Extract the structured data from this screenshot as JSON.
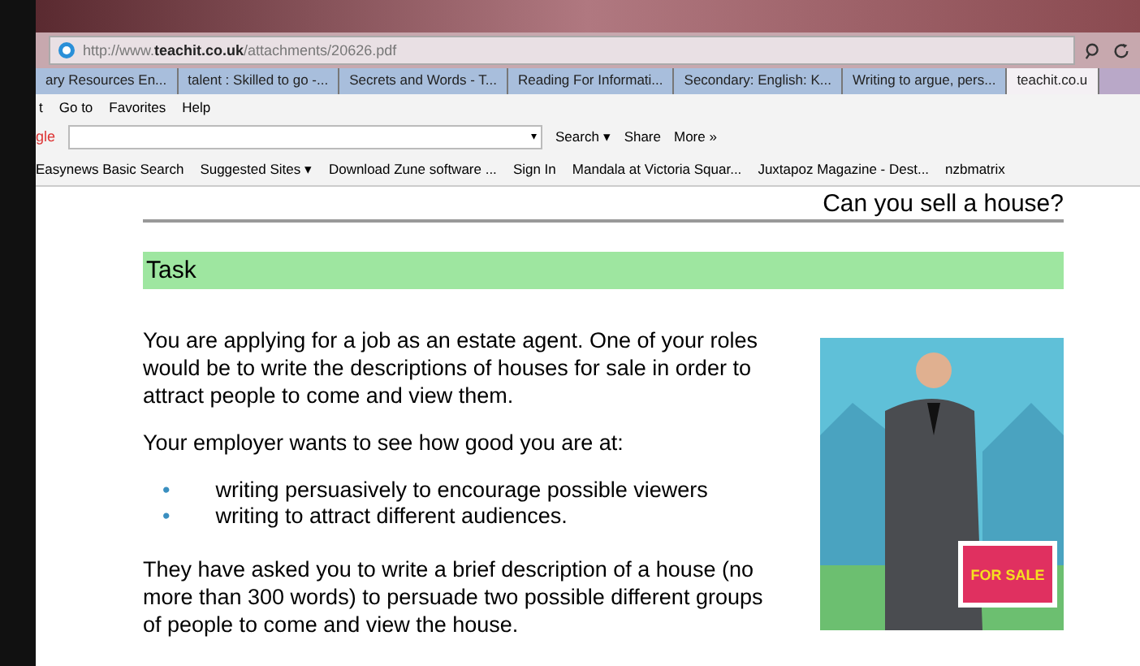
{
  "address_bar": {
    "url_prefix": "http://www.",
    "url_domain": "teachit.co.uk",
    "url_path": "/attachments/20626.pdf"
  },
  "tabs": [
    {
      "label": "ary Resources En...",
      "selected": false
    },
    {
      "label": "talent : Skilled to go -...",
      "selected": false
    },
    {
      "label": "Secrets and Words - T...",
      "selected": false
    },
    {
      "label": "Reading For Informati...",
      "selected": false
    },
    {
      "label": "Secondary: English: K...",
      "selected": false
    },
    {
      "label": "Writing to argue, pers...",
      "selected": false
    },
    {
      "label": "teachit.co.u",
      "selected": true
    }
  ],
  "menu": [
    "t",
    "Go to",
    "Favorites",
    "Help"
  ],
  "toolbar": {
    "logo": "gle",
    "field_caret": "▾",
    "search": "Search ▾",
    "share": "Share",
    "more": "More »"
  },
  "favorites": [
    "Easynews Basic Search",
    "Suggested Sites ▾",
    "Download Zune software ...",
    "Sign In",
    "Mandala at Victoria Squar...",
    "Juxtapoz Magazine - Dest...",
    "nzbmatrix"
  ],
  "document": {
    "heading": "Can you sell a house?",
    "task_title": "Task",
    "intro": "You are applying for a job as an estate agent.  One of your roles would be to write the descriptions of houses for sale in order to attract people to come and view them.",
    "lead": "Your employer wants to see how good you are at:",
    "bullet_marker": "•",
    "bullets": [
      "writing persuasively to encourage possible viewers",
      "writing to attract different audiences."
    ],
    "closing": "They have asked you to write a brief description of a house (no more than 300 words) to persuade two possible different groups of people to come and view the house.",
    "sign_text": "FOR SALE"
  }
}
